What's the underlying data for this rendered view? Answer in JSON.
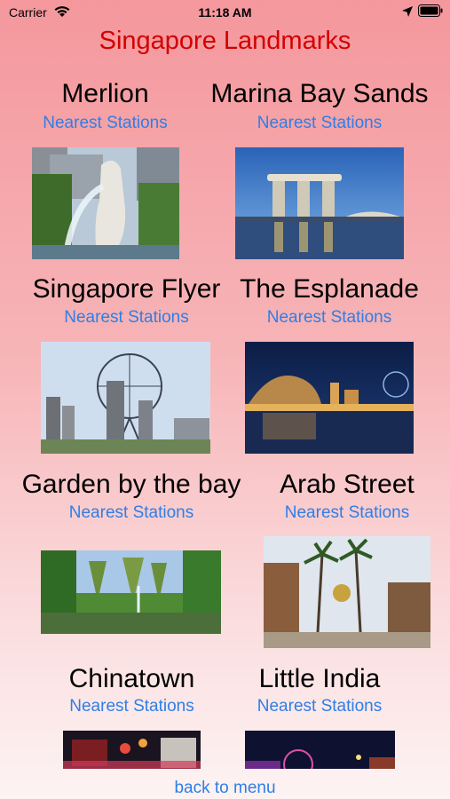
{
  "status": {
    "carrier": "Carrier",
    "time": "11:18 AM"
  },
  "title": "Singapore Landmarks",
  "landmarks": [
    {
      "name": "Merlion",
      "link": "Nearest Stations"
    },
    {
      "name": "Marina Bay Sands",
      "link": "Nearest Stations"
    },
    {
      "name": "Singapore Flyer",
      "link": "Nearest Stations"
    },
    {
      "name": "The Esplanade",
      "link": "Nearest Stations"
    },
    {
      "name": "Garden by the bay",
      "link": "Nearest Stations"
    },
    {
      "name": "Arab Street",
      "link": "Nearest Stations"
    },
    {
      "name": "Chinatown",
      "link": "Nearest Stations"
    },
    {
      "name": "Little India",
      "link": "Nearest Stations"
    }
  ],
  "back": "back to menu"
}
